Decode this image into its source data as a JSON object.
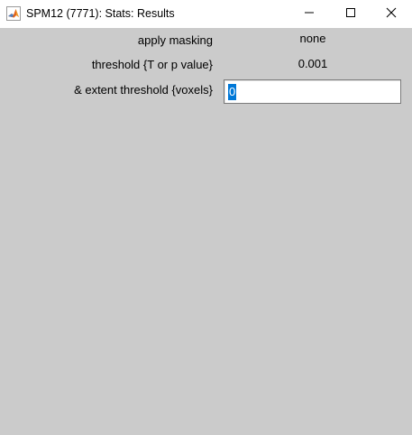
{
  "window": {
    "title": "SPM12 (7771): Stats: Results",
    "app_icon": "matlab-icon",
    "controls": {
      "minimize_icon": "minimize-icon",
      "maximize_icon": "maximize-icon",
      "close_icon": "close-icon"
    }
  },
  "form": {
    "apply_masking": {
      "label": "apply masking",
      "value": "none"
    },
    "threshold": {
      "label": "threshold {T or p value}",
      "value": "0.001"
    },
    "extent_threshold": {
      "label": "& extent threshold {voxels}",
      "value": "0"
    }
  },
  "colors": {
    "background": "#cbcbcb",
    "titlebar": "#ffffff",
    "selection": "#0078d7"
  }
}
